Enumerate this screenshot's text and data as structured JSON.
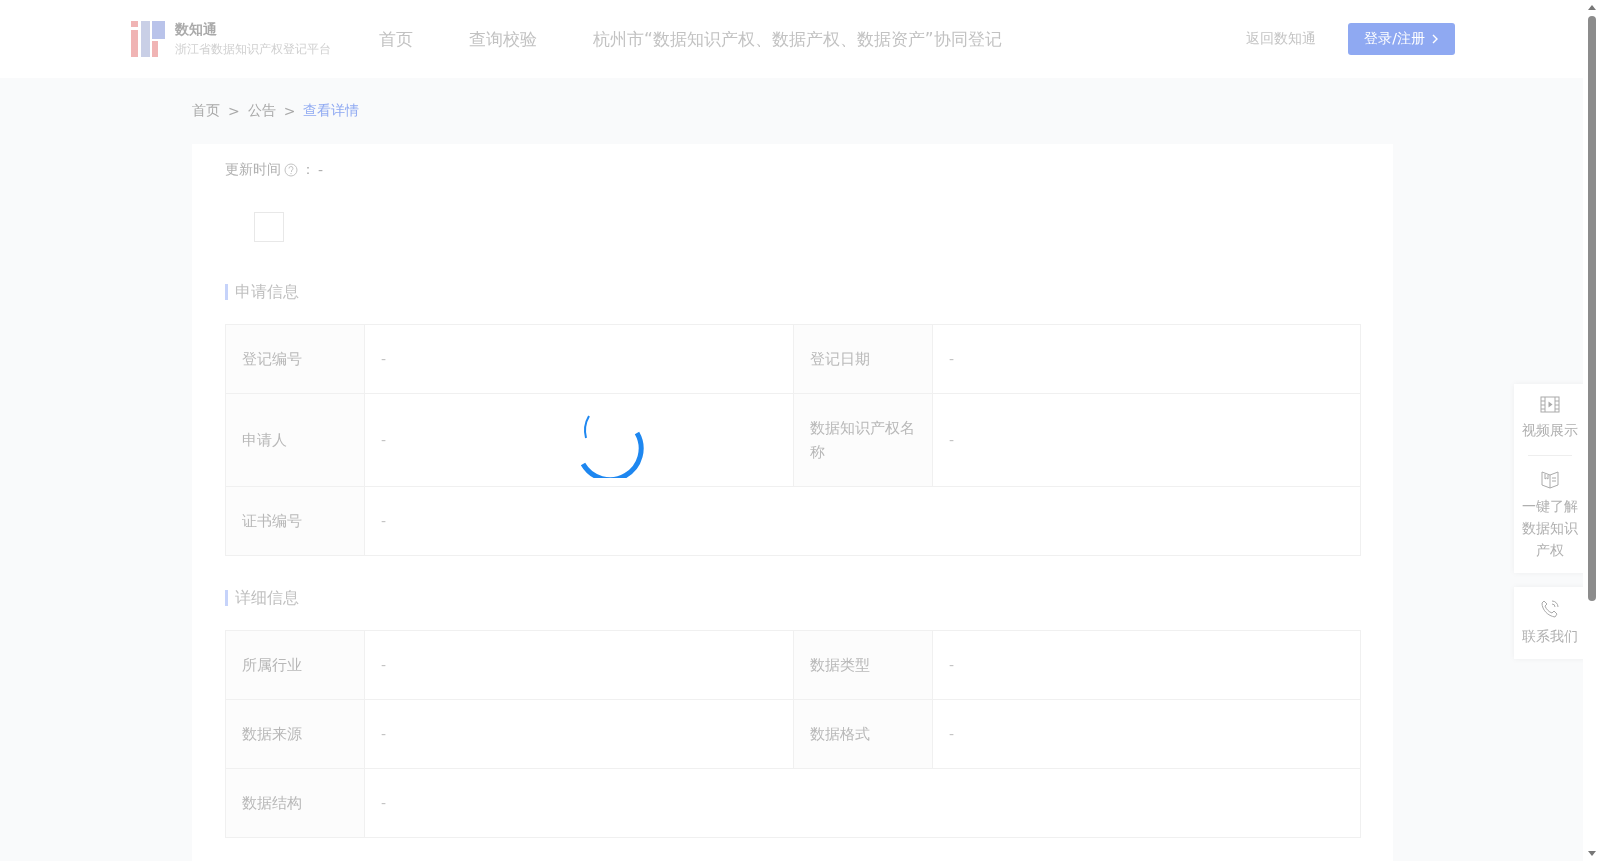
{
  "header": {
    "brand": "数知通",
    "subtitle": "浙江省数据知识产权登记平台",
    "nav": [
      "首页",
      "查询校验",
      "杭州市“数据知识产权、数据产权、数据资产”协同登记"
    ],
    "back_link": "返回数知通",
    "login_button": "登录/注册"
  },
  "breadcrumb": [
    {
      "label": "首页",
      "current": false
    },
    {
      "label": "公告",
      "current": false
    },
    {
      "label": "查看详情",
      "current": true
    }
  ],
  "breadcrumb_separator": ">",
  "update_time": {
    "label": "更新时间",
    "separator": "：",
    "value": "-"
  },
  "sections": [
    {
      "title": "申请信息",
      "rows": [
        [
          {
            "label": "登记编号",
            "value": "-"
          },
          {
            "label": "登记日期",
            "value": "-"
          }
        ],
        [
          {
            "label": "申请人",
            "value": "-"
          },
          {
            "label": "数据知识产权名称",
            "value": "-"
          }
        ],
        [
          {
            "label": "证书编号",
            "value": "-"
          }
        ]
      ]
    },
    {
      "title": "详细信息",
      "rows": [
        [
          {
            "label": "所属行业",
            "value": "-"
          },
          {
            "label": "数据类型",
            "value": "-"
          }
        ],
        [
          {
            "label": "数据来源",
            "value": "-"
          },
          {
            "label": "数据格式",
            "value": "-"
          }
        ],
        [
          {
            "label": "数据结构",
            "value": "-"
          }
        ]
      ]
    }
  ],
  "side_panel": [
    {
      "label": "视频展示",
      "kind": "video"
    },
    {
      "label": "一键了解数据知识产权",
      "kind": "book"
    },
    {
      "label": "联系我们",
      "kind": "phone"
    }
  ]
}
